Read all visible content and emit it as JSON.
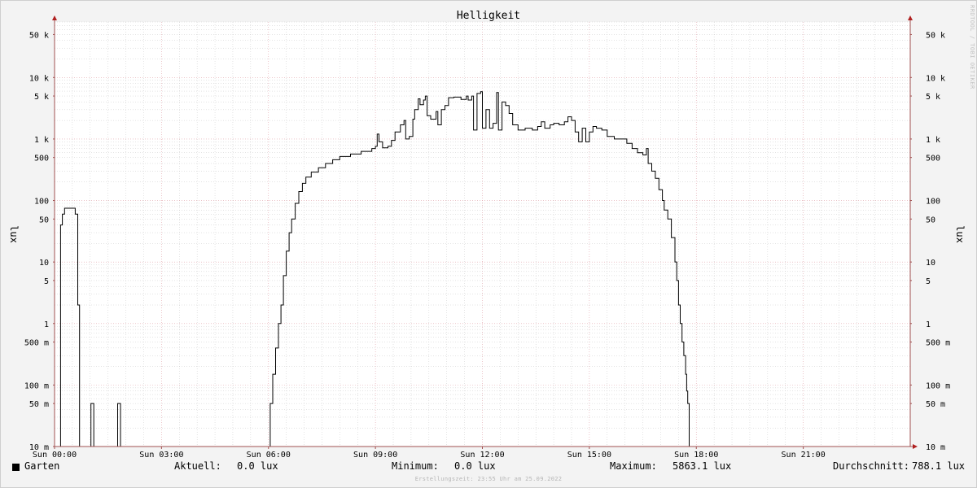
{
  "chart_data": {
    "type": "line",
    "title": "Helligkeit",
    "ylabel": "lux",
    "ylabel_right": "lux",
    "yscale": "log",
    "ylim": [
      0.01,
      80000
    ],
    "xlim": [
      0,
      24
    ],
    "x_tick_labels": [
      "Sun 00:00",
      "Sun 03:00",
      "Sun 06:00",
      "Sun 09:00",
      "Sun 12:00",
      "Sun 15:00",
      "Sun 18:00",
      "Sun 21:00"
    ],
    "x_tick_hours": [
      0,
      3,
      6,
      9,
      12,
      15,
      18,
      21
    ],
    "y_ticks": [
      {
        "value": 50000,
        "label": "50 k"
      },
      {
        "value": 10000,
        "label": "10 k"
      },
      {
        "value": 5000,
        "label": "5 k"
      },
      {
        "value": 1000,
        "label": "1 k"
      },
      {
        "value": 500,
        "label": "500"
      },
      {
        "value": 100,
        "label": "100"
      },
      {
        "value": 50,
        "label": "50"
      },
      {
        "value": 10,
        "label": "10"
      },
      {
        "value": 5,
        "label": "5"
      },
      {
        "value": 1,
        "label": "1"
      },
      {
        "value": 0.5,
        "label": "500 m"
      },
      {
        "value": 0.1,
        "label": "100 m"
      },
      {
        "value": 0.05,
        "label": "50 m"
      },
      {
        "value": 0.01,
        "label": "10 m"
      }
    ],
    "grid": true,
    "colors": {
      "line": "#000000",
      "major_grid": "#e0a0a8",
      "minor_grid": "#c8c8c8",
      "axis": "#a05050",
      "arrow": "#b02020",
      "plot_bg": "#ffffff"
    },
    "series": [
      {
        "name": "Garten",
        "points": [
          [
            0.0,
            0.01
          ],
          [
            0.15,
            0.01
          ],
          [
            0.17,
            40
          ],
          [
            0.22,
            60
          ],
          [
            0.28,
            75
          ],
          [
            0.55,
            75
          ],
          [
            0.58,
            60
          ],
          [
            0.65,
            2
          ],
          [
            0.7,
            0.01
          ],
          [
            1.0,
            0.01
          ],
          [
            1.02,
            0.05
          ],
          [
            1.08,
            0.05
          ],
          [
            1.1,
            0.01
          ],
          [
            1.75,
            0.01
          ],
          [
            1.77,
            0.05
          ],
          [
            1.83,
            0.05
          ],
          [
            1.85,
            0.01
          ],
          [
            6.0,
            0.01
          ],
          [
            6.05,
            0.05
          ],
          [
            6.12,
            0.15
          ],
          [
            6.2,
            0.4
          ],
          [
            6.28,
            1
          ],
          [
            6.35,
            2
          ],
          [
            6.42,
            6
          ],
          [
            6.5,
            15
          ],
          [
            6.58,
            30
          ],
          [
            6.65,
            50
          ],
          [
            6.75,
            90
          ],
          [
            6.85,
            140
          ],
          [
            6.95,
            190
          ],
          [
            7.05,
            240
          ],
          [
            7.2,
            290
          ],
          [
            7.4,
            340
          ],
          [
            7.6,
            400
          ],
          [
            7.8,
            460
          ],
          [
            8.0,
            520
          ],
          [
            8.3,
            570
          ],
          [
            8.6,
            630
          ],
          [
            8.9,
            700
          ],
          [
            9.0,
            760
          ],
          [
            9.05,
            1200
          ],
          [
            9.1,
            900
          ],
          [
            9.2,
            720
          ],
          [
            9.35,
            760
          ],
          [
            9.45,
            950
          ],
          [
            9.55,
            1300
          ],
          [
            9.7,
            1700
          ],
          [
            9.8,
            2000
          ],
          [
            9.85,
            1000
          ],
          [
            9.95,
            1100
          ],
          [
            10.05,
            2100
          ],
          [
            10.1,
            3000
          ],
          [
            10.2,
            4500
          ],
          [
            10.25,
            3600
          ],
          [
            10.35,
            4300
          ],
          [
            10.4,
            5000
          ],
          [
            10.45,
            2400
          ],
          [
            10.55,
            2100
          ],
          [
            10.7,
            2800
          ],
          [
            10.75,
            1700
          ],
          [
            10.85,
            3000
          ],
          [
            10.95,
            3500
          ],
          [
            11.05,
            4700
          ],
          [
            11.2,
            4800
          ],
          [
            11.4,
            4400
          ],
          [
            11.55,
            5000
          ],
          [
            11.6,
            4300
          ],
          [
            11.7,
            5000
          ],
          [
            11.75,
            1400
          ],
          [
            11.85,
            5500
          ],
          [
            11.95,
            5863
          ],
          [
            12.0,
            1500
          ],
          [
            12.1,
            3000
          ],
          [
            12.2,
            1500
          ],
          [
            12.3,
            1800
          ],
          [
            12.4,
            5700
          ],
          [
            12.45,
            1400
          ],
          [
            12.55,
            4000
          ],
          [
            12.65,
            3500
          ],
          [
            12.75,
            2600
          ],
          [
            12.85,
            1700
          ],
          [
            13.0,
            1400
          ],
          [
            13.2,
            1500
          ],
          [
            13.4,
            1400
          ],
          [
            13.55,
            1600
          ],
          [
            13.65,
            1900
          ],
          [
            13.75,
            1500
          ],
          [
            13.9,
            1700
          ],
          [
            14.0,
            1800
          ],
          [
            14.15,
            1700
          ],
          [
            14.3,
            1900
          ],
          [
            14.4,
            2300
          ],
          [
            14.5,
            2000
          ],
          [
            14.6,
            1300
          ],
          [
            14.7,
            900
          ],
          [
            14.8,
            1500
          ],
          [
            14.9,
            900
          ],
          [
            15.0,
            1300
          ],
          [
            15.1,
            1600
          ],
          [
            15.2,
            1500
          ],
          [
            15.35,
            1400
          ],
          [
            15.5,
            1100
          ],
          [
            15.7,
            1000
          ],
          [
            15.9,
            1000
          ],
          [
            16.05,
            850
          ],
          [
            16.2,
            700
          ],
          [
            16.35,
            600
          ],
          [
            16.5,
            550
          ],
          [
            16.6,
            700
          ],
          [
            16.65,
            400
          ],
          [
            16.75,
            300
          ],
          [
            16.85,
            230
          ],
          [
            16.95,
            150
          ],
          [
            17.05,
            100
          ],
          [
            17.1,
            70
          ],
          [
            17.2,
            50
          ],
          [
            17.3,
            25
          ],
          [
            17.4,
            10
          ],
          [
            17.45,
            5
          ],
          [
            17.5,
            2
          ],
          [
            17.55,
            1
          ],
          [
            17.6,
            0.5
          ],
          [
            17.65,
            0.3
          ],
          [
            17.7,
            0.15
          ],
          [
            17.73,
            0.08
          ],
          [
            17.76,
            0.05
          ],
          [
            17.8,
            0.01
          ],
          [
            24.0,
            0.01
          ]
        ]
      }
    ]
  },
  "legend": {
    "series_name": "Garten",
    "current_label": "Aktuell:",
    "current_value": "0.0 lux",
    "min_label": "Minimum:",
    "min_value": "0.0 lux",
    "max_label": "Maximum:",
    "max_value": "5863.1 lux",
    "avg_label": "Durchschnitt:",
    "avg_value": "788.1 lux"
  },
  "footer": "Erstellungszeit: 23:55 Uhr am 25.09.2022",
  "watermark": "RRDTOOL / TOBI OETIKER"
}
